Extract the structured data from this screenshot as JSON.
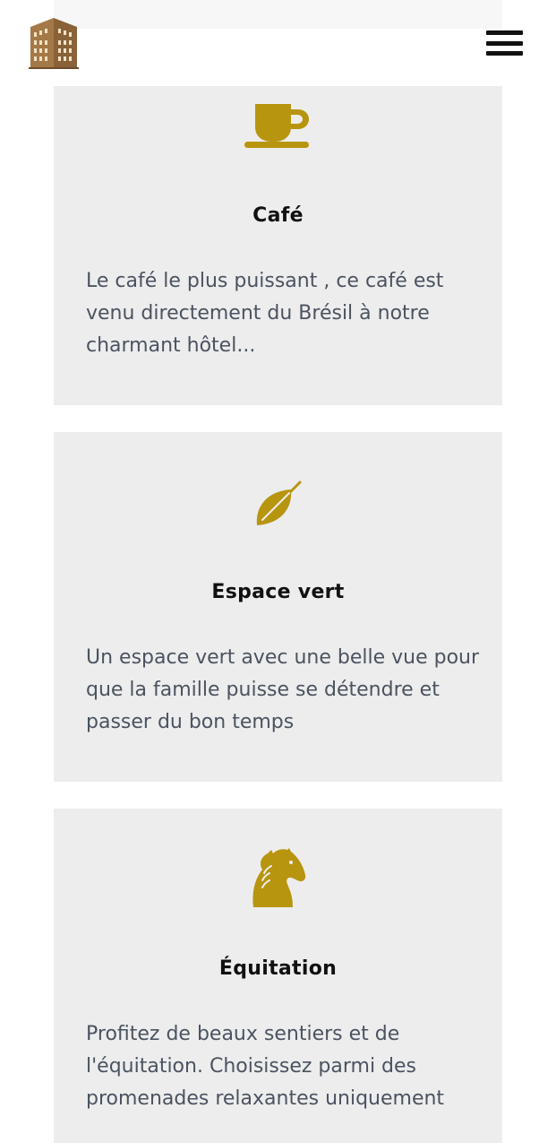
{
  "header": {
    "logo_icon": "building-logo-icon",
    "menu_icon": "hamburger-menu-icon"
  },
  "colors": {
    "accent": "#b8950f",
    "card_bg": "#ededed",
    "text": "#4b5361",
    "title": "#111111"
  },
  "services": [
    {
      "icon": "coffee-cup-icon",
      "title": "Café",
      "description": "Le café le plus puissant , ce café est venu directement du Brésil à notre charmant hôtel..."
    },
    {
      "icon": "leaf-icon",
      "title": "Espace vert",
      "description": "Un espace vert avec une belle vue pour que la famille puisse se détendre et passer du bon temps"
    },
    {
      "icon": "horse-head-icon",
      "title": "Équitation",
      "description": "Profitez de beaux sentiers et de l'équitation. Choisissez parmi des promenades relaxantes uniquement"
    }
  ]
}
